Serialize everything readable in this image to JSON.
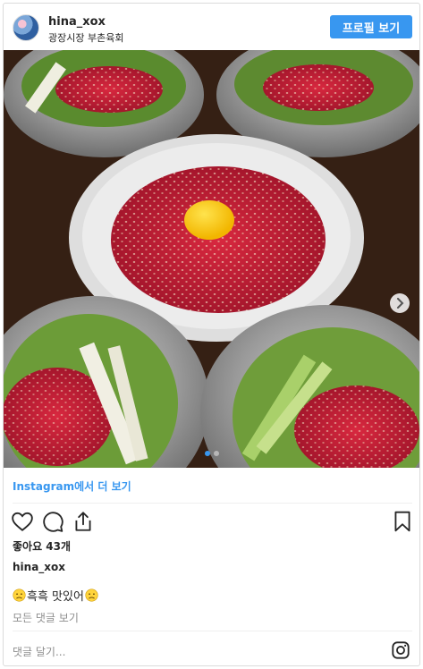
{
  "post": {
    "username": "hina_xox",
    "location": "광장시장 부촌육회",
    "profile_button": "프로필 보기",
    "more_on_instagram": "Instagram에서 더 보기",
    "likes": "좋아요 43개",
    "caption_user": "hina_xox",
    "caption_text": "흑흑 맛있어",
    "view_all_comments": "모든 댓글 보기",
    "add_comment_placeholder": "댓글 달기...",
    "carousel": {
      "current": 1,
      "total": 2
    }
  },
  "colors": {
    "accent": "#3897f0",
    "text": "#262626",
    "muted": "#8e8e8e",
    "border": "#dbdbdb"
  },
  "icons": {
    "like": "heart-icon",
    "comment": "comment-icon",
    "share": "share-icon",
    "save": "bookmark-icon",
    "next": "chevron-right-icon",
    "brand": "instagram-icon",
    "caption_emoji": "sad-face-emoji"
  }
}
